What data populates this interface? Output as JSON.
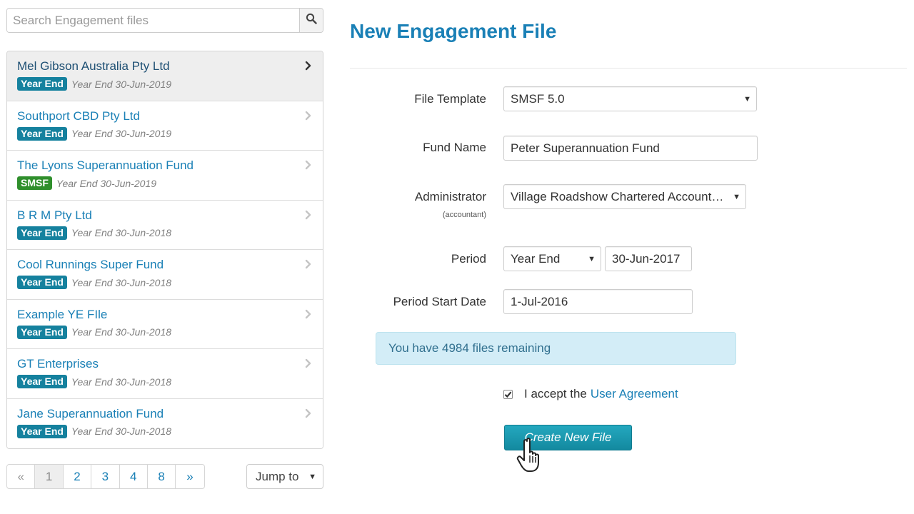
{
  "search": {
    "placeholder": "Search Engagement files",
    "icon": "search-icon"
  },
  "files": [
    {
      "name": "Mel Gibson Australia Pty Ltd",
      "badge": "Year End",
      "badge_type": "year-end",
      "date": "Year End 30-Jun-2019",
      "active": true
    },
    {
      "name": "Southport CBD Pty Ltd",
      "badge": "Year End",
      "badge_type": "year-end",
      "date": "Year End 30-Jun-2019"
    },
    {
      "name": "The Lyons Superannuation Fund",
      "badge": "SMSF",
      "badge_type": "smsf",
      "date": "Year End 30-Jun-2019"
    },
    {
      "name": "B R M Pty Ltd",
      "badge": "Year End",
      "badge_type": "year-end",
      "date": "Year End 30-Jun-2018"
    },
    {
      "name": "Cool Runnings Super Fund",
      "badge": "Year End",
      "badge_type": "year-end",
      "date": "Year End 30-Jun-2018"
    },
    {
      "name": "Example YE FIle",
      "badge": "Year End",
      "badge_type": "year-end",
      "date": "Year End 30-Jun-2018"
    },
    {
      "name": "GT Enterprises",
      "badge": "Year End",
      "badge_type": "year-end",
      "date": "Year End 30-Jun-2018"
    },
    {
      "name": "Jane Superannuation Fund",
      "badge": "Year End",
      "badge_type": "year-end",
      "date": "Year End 30-Jun-2018"
    }
  ],
  "pagination": {
    "prev": "«",
    "pages": [
      "1",
      "2",
      "3",
      "4",
      "8"
    ],
    "current": "1",
    "next": "»",
    "jump_label": "Jump to"
  },
  "form": {
    "title": "New Engagement File",
    "file_template_label": "File Template",
    "file_template_value": "SMSF 5.0",
    "fund_name_label": "Fund Name",
    "fund_name_value": "Peter Superannuation Fund",
    "administrator_label": "Administrator",
    "administrator_sublabel": "(accountant)",
    "administrator_value": "Village Roadshow Chartered Accountants",
    "period_label": "Period",
    "period_type_value": "Year End",
    "period_end_value": "30-Jun-2017",
    "period_start_label": "Period Start Date",
    "period_start_value": "1-Jul-2016",
    "files_remaining_text": "You have 4984 files remaining",
    "accept_text": "I accept the",
    "agreement_link": "User Agreement",
    "accept_checked": true,
    "submit_label": "Create New File"
  },
  "colors": {
    "brand_blue": "#1a80b6",
    "year_end_badge": "#15819e",
    "smsf_badge": "#2f8f2c",
    "button": "#1a9bb2",
    "alert_bg": "#d3edf7"
  }
}
